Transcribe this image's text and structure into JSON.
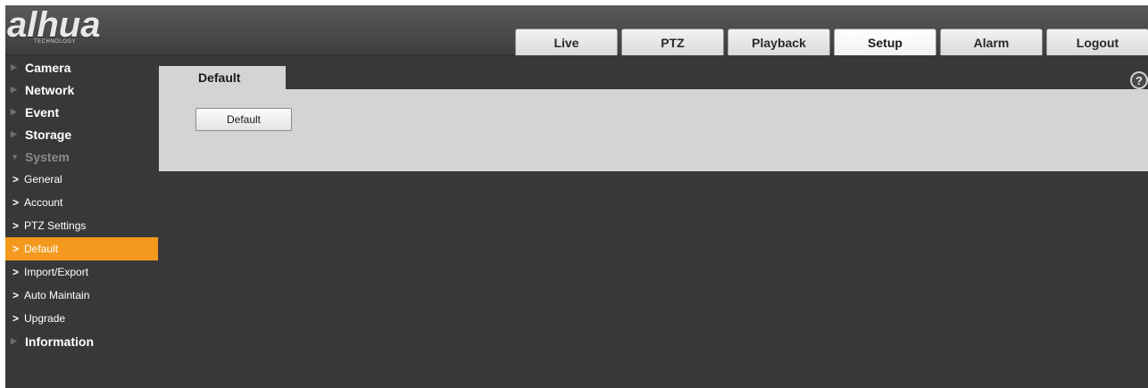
{
  "header": {
    "brand": "alhua",
    "brand_sub": "TECHNOLOGY",
    "tabs": [
      {
        "label": "Live"
      },
      {
        "label": "PTZ"
      },
      {
        "label": "Playback"
      },
      {
        "label": "Setup",
        "active": true
      },
      {
        "label": "Alarm"
      },
      {
        "label": "Logout"
      }
    ]
  },
  "sidebar": {
    "items": [
      {
        "label": "Camera"
      },
      {
        "label": "Network"
      },
      {
        "label": "Event"
      },
      {
        "label": "Storage"
      },
      {
        "label": "System",
        "expanded": true
      },
      {
        "label": "Information"
      }
    ],
    "system_sub": [
      {
        "label": "General"
      },
      {
        "label": "Account"
      },
      {
        "label": "PTZ Settings"
      },
      {
        "label": "Default",
        "active": true
      },
      {
        "label": "Import/Export"
      },
      {
        "label": "Auto Maintain"
      },
      {
        "label": "Upgrade"
      }
    ]
  },
  "main": {
    "tab_label": "Default",
    "button_label": "Default",
    "help_symbol": "?"
  },
  "colors": {
    "active_sidebar": "#f39a1e",
    "background": "#383838",
    "panel": "#d4d4d4"
  }
}
